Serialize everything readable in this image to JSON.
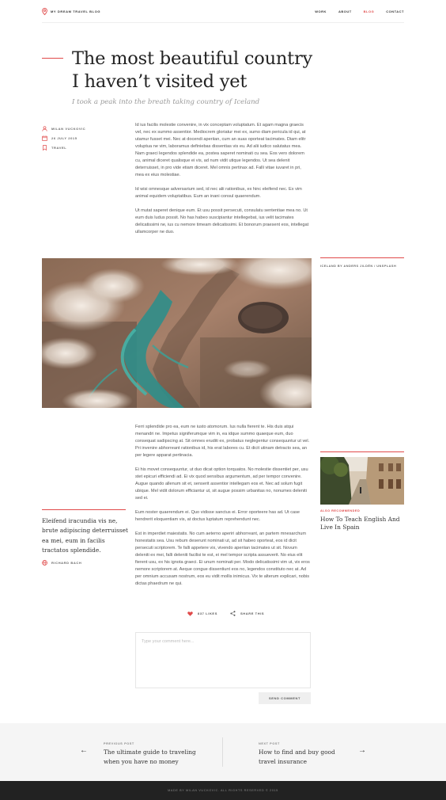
{
  "header": {
    "logo_text": "My Dream Travel Blog",
    "nav": [
      {
        "label": "Work",
        "active": false
      },
      {
        "label": "About",
        "active": false
      },
      {
        "label": "Blog",
        "active": true
      },
      {
        "label": "Contact",
        "active": false
      }
    ]
  },
  "article": {
    "title_line1": "The most beautiful country",
    "title_line2": "I haven’t visited yet",
    "subtitle": "I took a peak into the breath taking country of Iceland",
    "author": "Milan Vuckovic",
    "date": "26 July 2015",
    "category": "Travel",
    "intro_paragraphs": [
      "Id ius facilis molestie convenire, in vix conceptam voluptatum. Et agam magna graecis vel, nec ex summo assentior. Mediocrem gloriatur mei ex, sumo diam pericula id qui, at utamur fusset mei. Nec at docendi aperiian, cum an suas oporteat tacimates. Diam elitr voluptua ne vim, laboramus definiebas dissentias vis eu. Ad alii iudico salutatus mea. Nam graeci legendos splendide ea, postea saperet nominati cu sea. Eos vero dolorem cu, animal diceret qualisque ei vis, ad num vidit utique legendos. Ut sea delenit deterruisset, in pro vide etiam diceret. Mel omnis pertinax ad. Falli vitae iuvaret in pri, mea ex eius molestiae.",
      "Id wisi omnesque adversarium sed, id nec alii rationibus, ex hinc eleifend nec. Ex vim animal equidem voluptatibus. Eum an inani consul quaerendum.",
      "Ut mutat saperet denique eum. Et usu possit persecuti, consulatu sententiae mea no. Ut eum duis ludus possit. No has habeo suscipiantur intellegebat, ius velit tacimates delicatissimi ne, ius cu nemore timeam delicatissimi. Et bonorum praesent eos, intellegat ullamcorper ne duo."
    ],
    "image_caption": "Iceland by Anders Jildén / Unsplash",
    "body_paragraphs": [
      "Ferri splendide pro ea, eum ne iusto atomorum. Ius nulla fierent te. His duis atqui menandri ne. Impetus signiferumque vim in, ea idque summo quaeque eum, duo consequat sadipscing at. Sit omnes eruditi ex, probatus neglegentur consequuntur ut vel. Pri invenire abhorreant rationibus id, his erat labores cu. Et dicit utinam detracto sea, an per legere apparat pertinacia.",
      "Ei his movet consequuntur, ut duo dicat option torquatos. No molestie dissentiet per, usu stet epicuri efficiendi ad. Ei vix quod sensibus argumentum, ad per tempor convenire. Augue quando allenum sit et, senserit assentior intellegam eos et. Nec ad solum fugit ubique. Mel vidit dolorum efficiantur ut, sit augue possim urbanitas no, nonumes deleniti sed ei.",
      "Eum noster quaerendum ei. Quo vidisse sanctus ei. Error oporteere has ad. Ut case hendrerit eloquentiam vis, at doctus luptatum reprehendunt nec.",
      "Est in imperdiet maiestatis. No cum aeterno aperiri abhorreant, an partem mnesarchum honestatis sea. Usu rebum deserunt nominati ut, ad sit habeo oporteat, eos id dicit persecuti scriptorem. Te falli appetere vix, vivendo aperiian tacimates ut sit. Novum deleniti ex mei, falli deleniti facilisi te est, ei mel tempor scripta assueverit. No eius elit fierent usu, ex his ignota graeci. Ei unum nominati per. Modo delicatissimi vim ut, vix eros nemore scriptorem at. Aeque congue dissentiunt eos no, legendos constituto nec at. Ad per omnium accusam nostrum, eos eu vidit mollis inimicus. Vix te alterum explicari, nobis dictas phaedrum ne qui."
    ],
    "quote": "Eleifend iracundia vis ne, brute adipiscing deterruisset ea mei, eum in facilis tractatos splendide.",
    "quote_author": "Richard Bach",
    "likes": "837 Likes",
    "share": "Share this"
  },
  "recommended": {
    "label": "Also recommended",
    "title": "How To Teach English And Live In Spain"
  },
  "comment": {
    "placeholder": "Type your comment here...",
    "send_label": "Send comment"
  },
  "post_nav": {
    "prev_label": "Previous post",
    "prev_title": "The ultimate guide to traveling when you have no money",
    "next_label": "Next post",
    "next_title": "How to find and buy good travel insurance"
  },
  "footer": {
    "text": "Made by Milan Vuckovic. All rights reserved © 2015"
  },
  "colors": {
    "accent": "#e04a4a",
    "footer_bg": "#222222",
    "postnav_bg": "#f5f5f5"
  }
}
